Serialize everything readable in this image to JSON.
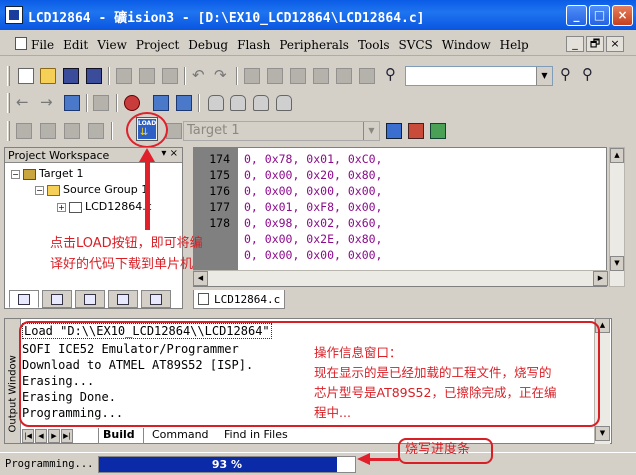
{
  "window": {
    "title": "LCD12864  - 礦ision3 - [D:\\EX10_LCD12864\\LCD12864.c]",
    "controls": {
      "minimize": "_",
      "maximize": "□",
      "close": "×"
    }
  },
  "menu": {
    "items": [
      "File",
      "Edit",
      "View",
      "Project",
      "Debug",
      "Flash",
      "Peripherals",
      "Tools",
      "SVCS",
      "Window",
      "Help"
    ],
    "mdi_controls": [
      "_",
      "🗗",
      "×"
    ]
  },
  "toolbar": {
    "target_combo": "Target 1",
    "load_button_label": "LOAD"
  },
  "workspace": {
    "title": "Project Workspace",
    "head_buttons": "▾ ×",
    "tree": [
      {
        "label": "Target 1",
        "expander": "−"
      },
      {
        "label": "Source Group 1",
        "expander": "−"
      },
      {
        "label": "LCD12864.c",
        "expander": "+"
      }
    ]
  },
  "editor": {
    "lines": [
      {
        "num": "174",
        "text": "0, 0x78, 0x01, 0xC0,"
      },
      {
        "num": "175",
        "text": "0, 0x00, 0x20, 0x80,"
      },
      {
        "num": "176",
        "text": "0, 0x00, 0x00, 0x00,"
      },
      {
        "num": "177",
        "text": "0, 0x01, 0xF8, 0x00,"
      },
      {
        "num": "178",
        "text": "0, 0x98, 0x02, 0x60,"
      },
      {
        "num": "",
        "text": "0, 0x00, 0x2E, 0x80,"
      },
      {
        "num": "",
        "text": "0, 0x00, 0x00, 0x00,"
      }
    ],
    "file_tab": "LCD12864.c"
  },
  "output": {
    "side_title": "Output Window",
    "lines": [
      "Load \"D:\\\\EX10_LCD12864\\\\LCD12864\"",
      "SOFI ICE52 Emulator/Programmer",
      "Download to ATMEL   AT89S52 [ISP].",
      "Erasing...",
      "Erasing Done.",
      "Programming..."
    ],
    "tabs": [
      "Build",
      "Command",
      "Find in Files"
    ]
  },
  "status": {
    "text": "Programming...",
    "progress_value": 0.93,
    "progress_label": "93 %"
  },
  "annotations": {
    "load_tip": [
      "点击LOAD按钮，即可将编",
      "译好的代码下载到单片机"
    ],
    "output_tip": [
      "操作信息窗口：",
      "现在显示的是已经加载的工程文件，烧写的",
      "芯片型号是AT89S52，已擦除完成，正在编",
      "程中..."
    ],
    "progress_tip": "烧写进度条"
  },
  "colors": {
    "annotation_red": "#d81f26",
    "code_text": "#8b0a8b",
    "progress_fill": "#0a2aa8",
    "titlebar_blue": "#0a5ce6"
  }
}
